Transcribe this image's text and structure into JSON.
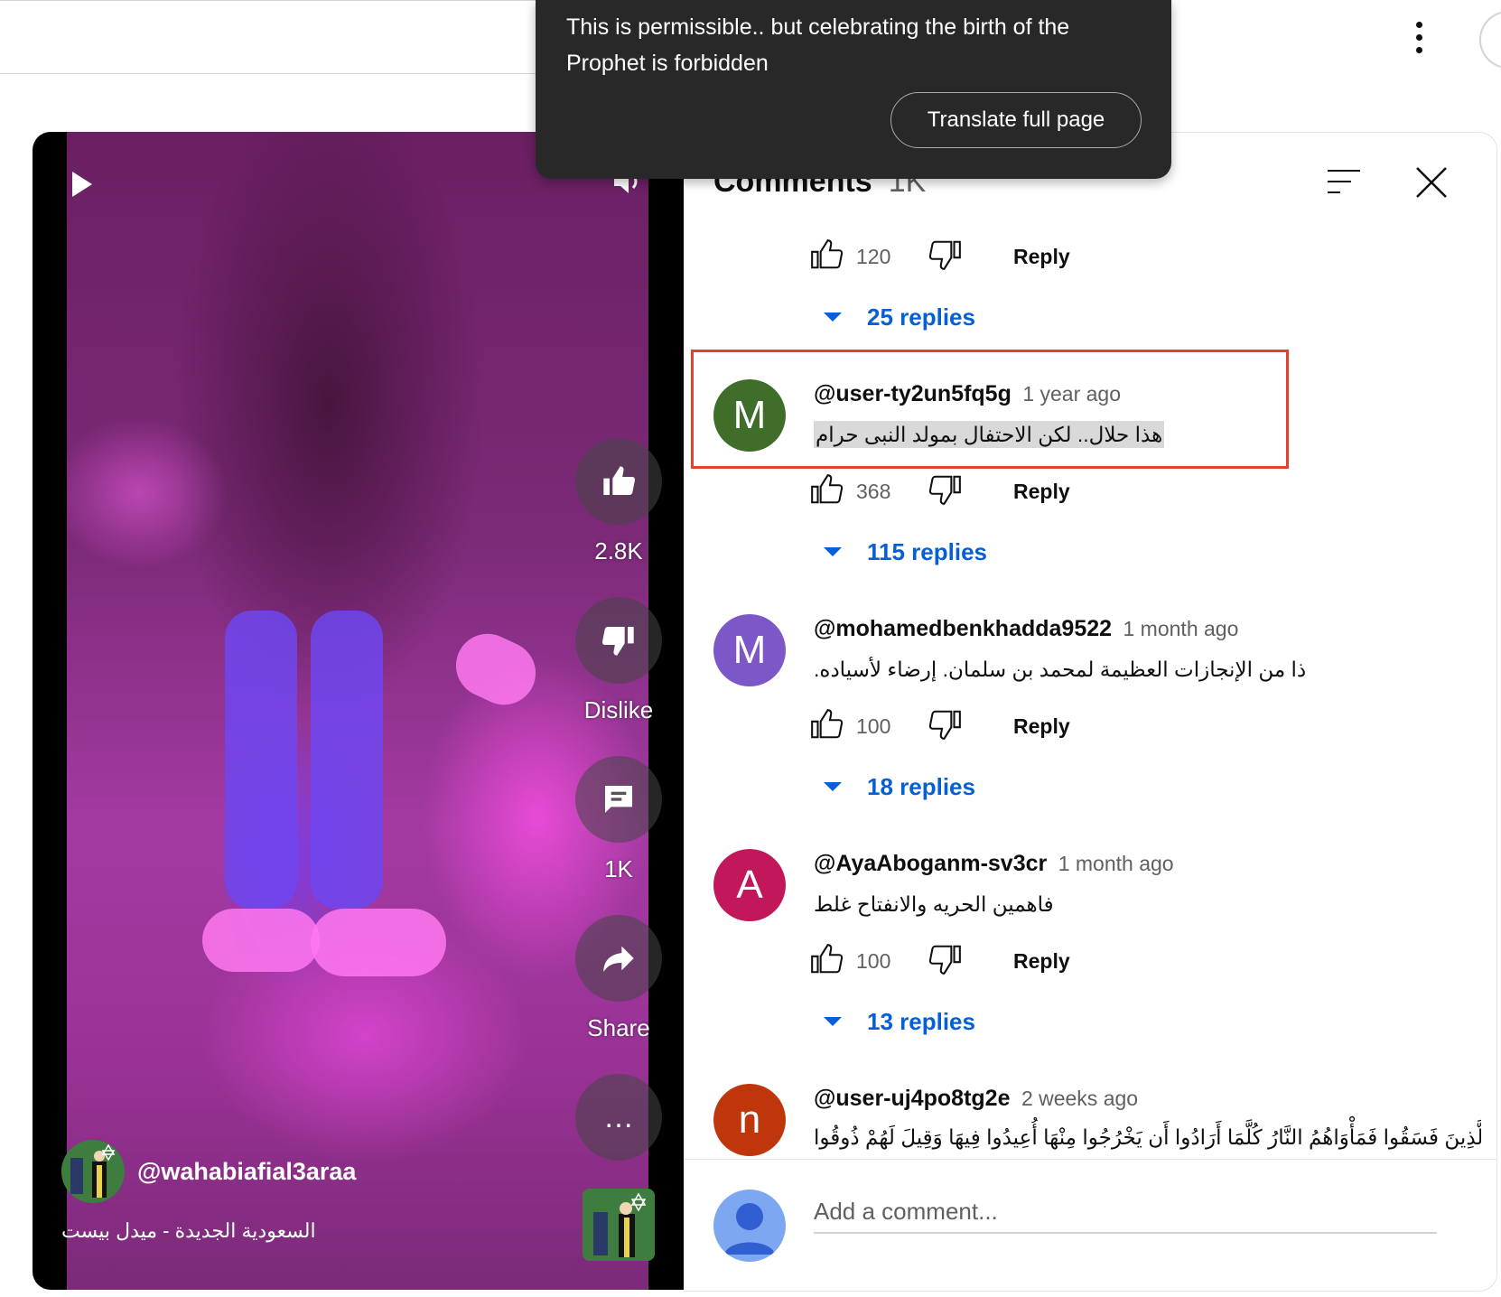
{
  "translate_popup": {
    "text": "This is permissible.. but celebrating the birth of the Prophet is forbidden",
    "button": "Translate full page"
  },
  "player": {
    "actions": {
      "like_count": "2.8K",
      "dislike_label": "Dislike",
      "comment_count": "1K",
      "share_label": "Share",
      "more_label": "…"
    },
    "channel": "@wahabiafial3araa",
    "title": "السعودية الجديدة - ميدل بيست"
  },
  "comments": {
    "title": "Comments",
    "count": "1K",
    "add_placeholder": "Add a comment...",
    "reply_label": "Reply",
    "top_row": {
      "likes": "120",
      "replies": "25 replies"
    },
    "items": [
      {
        "initial": "M",
        "avatar_color": "#3f6d2a",
        "author": "@user-ty2un5fq5g",
        "time": "1 year ago",
        "text": "هذا حلال.. لكن الاحتفال بمولد النبى حرام",
        "likes": "368",
        "replies": "115 replies"
      },
      {
        "initial": "M",
        "avatar_color": "#7b57c8",
        "author": "@mohamedbenkhadda9522",
        "time": "1 month ago",
        "text": "ذا من الإنجازات العظيمة لمحمد بن سلمان. إرضاء لأسياده.",
        "likes": "100",
        "replies": "18 replies"
      },
      {
        "initial": "A",
        "avatar_color": "#c2185b",
        "author": "@AyaAboganm-sv3cr",
        "time": "1 month ago",
        "text": "فاهمين الحريه والانفتاح غلط",
        "likes": "100",
        "replies": "13 replies"
      },
      {
        "initial": "n",
        "avatar_color": "#bf360c",
        "author": "@user-uj4po8tg2e",
        "time": "2 weeks ago",
        "text": "وَأَمَّا الَّذِينَ فَسَقُوا فَمَأْوَاهُمُ النَّارُ كُلَّمَا أَرَادُوا أَن يَخْرُجُوا مِنْهَا أُعِيدُوا فِيهَا وَقِيلَ لَهُمْ ذُوقُوا"
      }
    ]
  },
  "icons": {
    "like": "thumb-up-icon",
    "dislike": "thumb-down-icon",
    "comment": "comment-icon",
    "share": "share-icon",
    "sort": "sort-icon",
    "close": "close-icon"
  }
}
